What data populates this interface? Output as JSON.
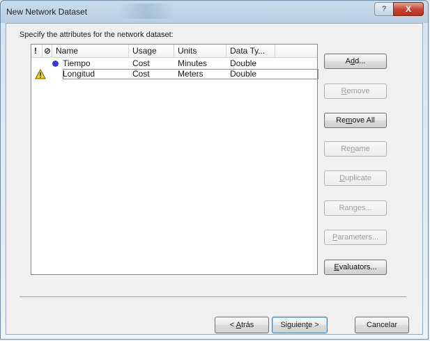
{
  "window": {
    "title": "New Network Dataset",
    "help_glyph": "?",
    "close_glyph": "X"
  },
  "instructions": "Specify the attributes for the network dataset:",
  "list": {
    "columns": [
      {
        "key": "warn",
        "label": "!"
      },
      {
        "key": "def",
        "label": "⊘"
      },
      {
        "key": "name",
        "label": "Name"
      },
      {
        "key": "usage",
        "label": "Usage"
      },
      {
        "key": "units",
        "label": "Units"
      },
      {
        "key": "datatype",
        "label": "Data Ty..."
      }
    ],
    "rows": [
      {
        "warning": false,
        "default": true,
        "name": "Tiempo",
        "usage": "Cost",
        "units": "Minutes",
        "datatype": "Double"
      },
      {
        "warning": true,
        "default": false,
        "name": "Longitud",
        "usage": "Cost",
        "units": "Meters",
        "datatype": "Double"
      }
    ]
  },
  "side_buttons": [
    {
      "id": "add",
      "pre": "A",
      "mn": "d",
      "post": "d...",
      "enabled": true
    },
    {
      "id": "remove",
      "pre": "",
      "mn": "R",
      "post": "emove",
      "enabled": false
    },
    {
      "id": "remove-all",
      "pre": "Re",
      "mn": "m",
      "post": "ove All",
      "enabled": true
    },
    {
      "id": "rename",
      "pre": "Re",
      "mn": "n",
      "post": "ame",
      "enabled": false
    },
    {
      "id": "duplicate",
      "pre": "",
      "mn": "D",
      "post": "uplicate",
      "enabled": false
    },
    {
      "id": "ranges",
      "pre": "Ran",
      "mn": "g",
      "post": "es...",
      "enabled": false
    },
    {
      "id": "parameters",
      "pre": "",
      "mn": "P",
      "post": "arameters...",
      "enabled": false
    },
    {
      "id": "evaluators",
      "pre": "",
      "mn": "E",
      "post": "valuators...",
      "enabled": true
    }
  ],
  "footer": {
    "back": {
      "pre": "< ",
      "mn": "A",
      "post": "trás"
    },
    "next": {
      "pre": "Siguien",
      "mn": "t",
      "post": "e >"
    },
    "cancel": {
      "label": "Cancelar"
    }
  }
}
